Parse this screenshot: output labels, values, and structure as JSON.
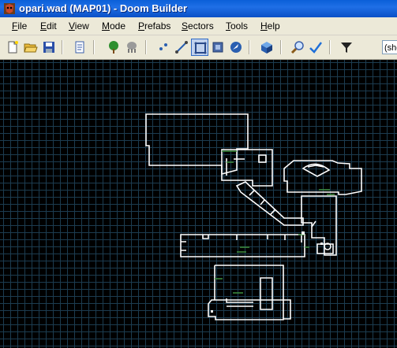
{
  "window": {
    "title": "opari.wad (MAP01) - Doom Builder"
  },
  "menu": {
    "items": [
      {
        "key": "F",
        "rest": "ile"
      },
      {
        "key": "E",
        "rest": "dit"
      },
      {
        "key": "V",
        "rest": "iew"
      },
      {
        "key": "M",
        "rest": "ode"
      },
      {
        "key": "P",
        "rest": "refabs"
      },
      {
        "key": "S",
        "rest": "ectors"
      },
      {
        "key": "T",
        "rest": "ools"
      },
      {
        "key": "H",
        "rest": "elp"
      }
    ]
  },
  "toolbar": {
    "buttons": [
      "new-map-icon",
      "open-map-icon",
      "save-map-icon",
      "map-options-icon",
      "things-filter-icon",
      "things-filter-disabled-icon",
      "vertices-mode-icon",
      "linedefs-mode-icon",
      "sectors-mode-icon",
      "things-mode-icon",
      "3d-mode-icon",
      "zoom-icon",
      "check-map-icon",
      "filter-icon"
    ],
    "active_mode": "sectors-mode-icon",
    "filter_value": "(sho"
  },
  "colors": {
    "linedef": "#ffffff",
    "two_sided": "#3f8f3f",
    "grid": "#1c3c50",
    "title_bar": "#0a5fd8"
  }
}
